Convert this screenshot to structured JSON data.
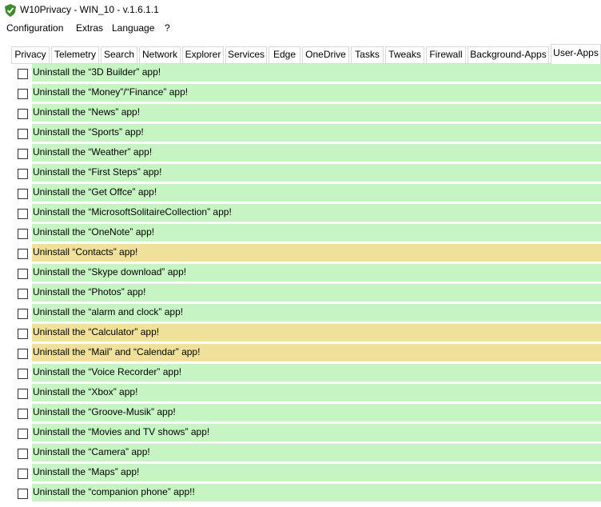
{
  "window": {
    "title": "W10Privacy - WIN_10 - v.1.6.1.1",
    "icon": "shield-check-icon"
  },
  "menu": [
    {
      "label": "Configuration"
    },
    {
      "label": "Extras"
    },
    {
      "label": "Language"
    },
    {
      "label": "?"
    }
  ],
  "tabs": [
    {
      "label": "Privacy"
    },
    {
      "label": "Telemetry"
    },
    {
      "label": "Search"
    },
    {
      "label": "Network"
    },
    {
      "label": "Explorer"
    },
    {
      "label": "Services"
    },
    {
      "label": "Edge"
    },
    {
      "label": "OneDrive"
    },
    {
      "label": "Tasks"
    },
    {
      "label": "Tweaks"
    },
    {
      "label": "Firewall"
    },
    {
      "label": "Background-Apps"
    },
    {
      "label": "User-Apps",
      "active": true
    }
  ],
  "colors": {
    "recommended": "#c6f5c3",
    "conditional": "#f0e19a"
  },
  "items": [
    {
      "label": "Uninstall the “3D Builder” app!",
      "color": "green",
      "checked": false
    },
    {
      "label": "Uninstall the “Money”/“Finance” app!",
      "color": "green",
      "checked": false
    },
    {
      "label": "Uninstall the “News” app!",
      "color": "green",
      "checked": false
    },
    {
      "label": "Uninstall the “Sports” app!",
      "color": "green",
      "checked": false
    },
    {
      "label": "Uninstall the “Weather” app!",
      "color": "green",
      "checked": false
    },
    {
      "label": "Uninstall the “First Steps” app!",
      "color": "green",
      "checked": false
    },
    {
      "label": "Uninstall the “Get Offce” app!",
      "color": "green",
      "checked": false
    },
    {
      "label": "Uninstall the “MicrosoftSolitaireCollection” app!",
      "color": "green",
      "checked": false
    },
    {
      "label": "Uninstall the “OneNote” app!",
      "color": "green",
      "checked": false
    },
    {
      "label": "Uninstall “Contacts” app!",
      "color": "yellow",
      "checked": false
    },
    {
      "label": "Uninstall the “Skype download” app!",
      "color": "green",
      "checked": false
    },
    {
      "label": "Uninstall the “Photos” app!",
      "color": "green",
      "checked": false
    },
    {
      "label": "Uninstall the “alarm and clock” app!",
      "color": "green",
      "checked": false
    },
    {
      "label": "Uninstall the “Calculator” app!",
      "color": "yellow",
      "checked": false
    },
    {
      "label": "Uninstall the “Mail” and “Calendar” app!",
      "color": "yellow",
      "checked": false
    },
    {
      "label": "Uninstall the “Voice Recorder” app!",
      "color": "green",
      "checked": false
    },
    {
      "label": "Uninstall the “Xbox” app!",
      "color": "green",
      "checked": false
    },
    {
      "label": "Uninstall the “Groove-Musik” app!",
      "color": "green",
      "checked": false
    },
    {
      "label": "Uninstall the “Movies and TV shows” app!",
      "color": "green",
      "checked": false
    },
    {
      "label": "Uninstall the “Camera” app!",
      "color": "green",
      "checked": false
    },
    {
      "label": "Uninstall the “Maps” app!",
      "color": "green",
      "checked": false
    },
    {
      "label": "Uninstall the “companion phone” app!!",
      "color": "green",
      "checked": false
    }
  ]
}
